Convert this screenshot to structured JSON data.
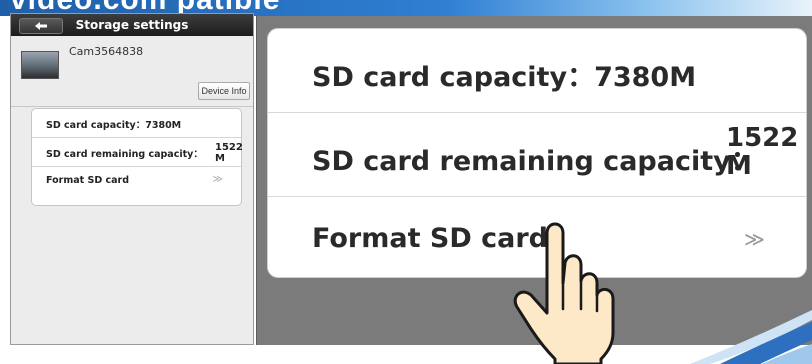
{
  "banner": {
    "text": "video.com patible"
  },
  "small_app": {
    "back_icon": "back-arrow-icon",
    "title": "Storage settings",
    "camera": {
      "name": "Cam3564838",
      "device_info_label": "Device Info"
    },
    "rows": {
      "capacity_label": "SD card capacity：7380M",
      "remaining_label": "SD card remaining capacity：",
      "remaining_value": "1522 M",
      "format_label": "Format SD card",
      "format_chevron": "≫"
    }
  },
  "zoom_panel": {
    "capacity_label": "SD card capacity：7380M",
    "remaining_label": "SD card remaining capacity：",
    "remaining_value": "1522 M",
    "format_label": "Format SD card",
    "format_chevron": "≫"
  },
  "overlay": {
    "pointer_icon": "pointing-hand-icon"
  },
  "colors": {
    "banner_blue": "#2f7fd3",
    "header_dark": "#1c1c1c",
    "panel_gray": "#7b7b7b",
    "hand_skin": "#fde8c8"
  }
}
